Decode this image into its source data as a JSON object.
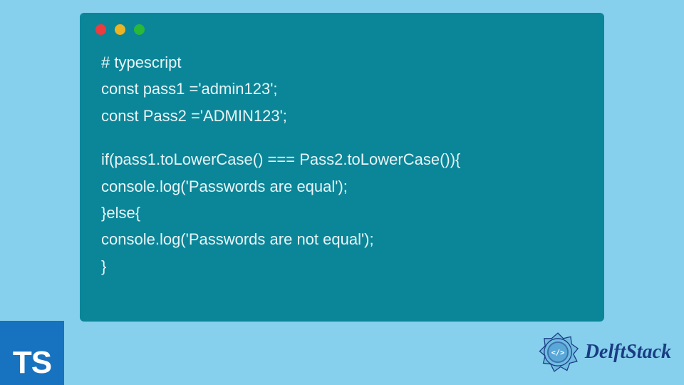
{
  "code": {
    "lines": [
      "# typescript",
      "const pass1 ='admin123';",
      "const Pass2 ='ADMIN123';",
      "",
      "if(pass1.toLowerCase() === Pass2.toLowerCase()){",
      "console.log('Passwords are equal');",
      "}else{",
      "console.log('Passwords are not equal');",
      "}"
    ]
  },
  "ts_badge": {
    "label": "TS"
  },
  "brand": {
    "name": "DelftStack"
  },
  "colors": {
    "page_bg": "#86d0ed",
    "window_bg": "#0b8699",
    "ts_bg": "#1773c0",
    "brand_text": "#1a3c83"
  }
}
